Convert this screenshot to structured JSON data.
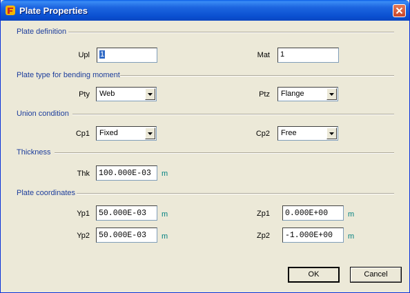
{
  "window": {
    "title": "Plate Properties",
    "app_icon": "app-logo-icon",
    "close_icon": "close-icon"
  },
  "sections": {
    "plate_definition": "Plate definition",
    "plate_type": "Plate type for bending moment",
    "union_condition": "Union condition",
    "thickness": "Thickness",
    "plate_coordinates": "Plate coordinates"
  },
  "fields": {
    "upl": {
      "label": "Upl",
      "value": "1"
    },
    "mat": {
      "label": "Mat",
      "value": "1"
    },
    "pty": {
      "label": "Pty",
      "value": "Web"
    },
    "ptz": {
      "label": "Ptz",
      "value": "Flange"
    },
    "cp1": {
      "label": "Cp1",
      "value": "Fixed"
    },
    "cp2": {
      "label": "Cp2",
      "value": "Free"
    },
    "thk": {
      "label": "Thk",
      "value": "100.000E-03",
      "unit": "m"
    },
    "yp1": {
      "label": "Yp1",
      "value": "50.000E-03",
      "unit": "m"
    },
    "yp2": {
      "label": "Yp2",
      "value": "50.000E-03",
      "unit": "m"
    },
    "zp1": {
      "label": "Zp1",
      "value": "0.000E+00",
      "unit": "m"
    },
    "zp2": {
      "label": "Zp2",
      "value": "-1.000E+00",
      "unit": "m"
    }
  },
  "buttons": {
    "ok": "OK",
    "cancel": "Cancel"
  },
  "colors": {
    "titlebar": "#0a4fd0",
    "section_text": "#1c3d9c",
    "unit_text": "#008080",
    "selection": "#316ac5"
  }
}
